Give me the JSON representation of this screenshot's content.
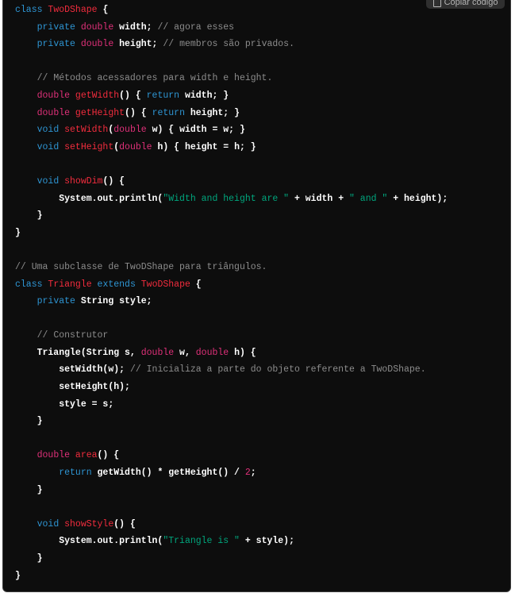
{
  "copy_button": {
    "label": "Copiar código",
    "icon": "copy-icon"
  },
  "colors": {
    "keyword": "#2e95d3",
    "type": "#df3079",
    "name": "#f22c3d",
    "string": "#00a67d",
    "comment": "#8c8c8c",
    "background": "#0d0d0d"
  },
  "code_lines": [
    [
      [
        "k",
        "class "
      ],
      [
        "f",
        "TwoDShape"
      ],
      [
        "n",
        " {"
      ]
    ],
    [
      [
        "n",
        "    "
      ],
      [
        "k",
        "private "
      ],
      [
        "t",
        "double "
      ],
      [
        "n",
        "width; "
      ],
      [
        "m",
        "// agora esses"
      ]
    ],
    [
      [
        "n",
        "    "
      ],
      [
        "k",
        "private "
      ],
      [
        "t",
        "double "
      ],
      [
        "n",
        "height; "
      ],
      [
        "m",
        "// membros são privados."
      ]
    ],
    [],
    [
      [
        "n",
        "    "
      ],
      [
        "m",
        "// Métodos acessadores para width e height."
      ]
    ],
    [
      [
        "n",
        "    "
      ],
      [
        "t",
        "double "
      ],
      [
        "f",
        "getWidth"
      ],
      [
        "n",
        "() { "
      ],
      [
        "k",
        "return "
      ],
      [
        "n",
        "width; }"
      ]
    ],
    [
      [
        "n",
        "    "
      ],
      [
        "t",
        "double "
      ],
      [
        "f",
        "getHeight"
      ],
      [
        "n",
        "() { "
      ],
      [
        "k",
        "return "
      ],
      [
        "n",
        "height; }"
      ]
    ],
    [
      [
        "n",
        "    "
      ],
      [
        "k",
        "void "
      ],
      [
        "f",
        "setWidth"
      ],
      [
        "n",
        "("
      ],
      [
        "t",
        "double "
      ],
      [
        "n",
        "w) { width = w; }"
      ]
    ],
    [
      [
        "n",
        "    "
      ],
      [
        "k",
        "void "
      ],
      [
        "f",
        "setHeight"
      ],
      [
        "n",
        "("
      ],
      [
        "t",
        "double "
      ],
      [
        "n",
        "h) { height = h; }"
      ]
    ],
    [],
    [
      [
        "n",
        "    "
      ],
      [
        "k",
        "void "
      ],
      [
        "f",
        "showDim"
      ],
      [
        "n",
        "() {"
      ]
    ],
    [
      [
        "n",
        "        System.out.println("
      ],
      [
        "s",
        "\"Width and height are \""
      ],
      [
        "n",
        " + width + "
      ],
      [
        "s",
        "\" and \""
      ],
      [
        "n",
        " + height);"
      ]
    ],
    [
      [
        "n",
        "    }"
      ]
    ],
    [
      [
        "n",
        "}"
      ]
    ],
    [],
    [
      [
        "m",
        "// Uma subclasse de TwoDShape para triângulos."
      ]
    ],
    [
      [
        "k",
        "class "
      ],
      [
        "f",
        "Triangle "
      ],
      [
        "k",
        "extends "
      ],
      [
        "f",
        "TwoDShape"
      ],
      [
        "n",
        " {"
      ]
    ],
    [
      [
        "n",
        "    "
      ],
      [
        "k",
        "private "
      ],
      [
        "n",
        "String style;"
      ]
    ],
    [],
    [
      [
        "n",
        "    "
      ],
      [
        "m",
        "// Construtor"
      ]
    ],
    [
      [
        "n",
        "    Triangle(String s, "
      ],
      [
        "t",
        "double "
      ],
      [
        "n",
        "w, "
      ],
      [
        "t",
        "double "
      ],
      [
        "n",
        "h) {"
      ]
    ],
    [
      [
        "n",
        "        setWidth(w); "
      ],
      [
        "m",
        "// Inicializa a parte do objeto referente a TwoDShape."
      ]
    ],
    [
      [
        "n",
        "        setHeight(h);"
      ]
    ],
    [
      [
        "n",
        "        style = s;"
      ]
    ],
    [
      [
        "n",
        "    }"
      ]
    ],
    [],
    [
      [
        "n",
        "    "
      ],
      [
        "t",
        "double "
      ],
      [
        "f",
        "area"
      ],
      [
        "n",
        "() {"
      ]
    ],
    [
      [
        "n",
        "        "
      ],
      [
        "k",
        "return "
      ],
      [
        "n",
        "getWidth() * getHeight() / "
      ],
      [
        "t",
        "2"
      ],
      [
        "n",
        ";"
      ]
    ],
    [
      [
        "n",
        "    }"
      ]
    ],
    [],
    [
      [
        "n",
        "    "
      ],
      [
        "k",
        "void "
      ],
      [
        "f",
        "showStyle"
      ],
      [
        "n",
        "() {"
      ]
    ],
    [
      [
        "n",
        "        System.out.println("
      ],
      [
        "s",
        "\"Triangle is \""
      ],
      [
        "n",
        " + style);"
      ]
    ],
    [
      [
        "n",
        "    }"
      ]
    ],
    [
      [
        "n",
        "}"
      ]
    ]
  ]
}
